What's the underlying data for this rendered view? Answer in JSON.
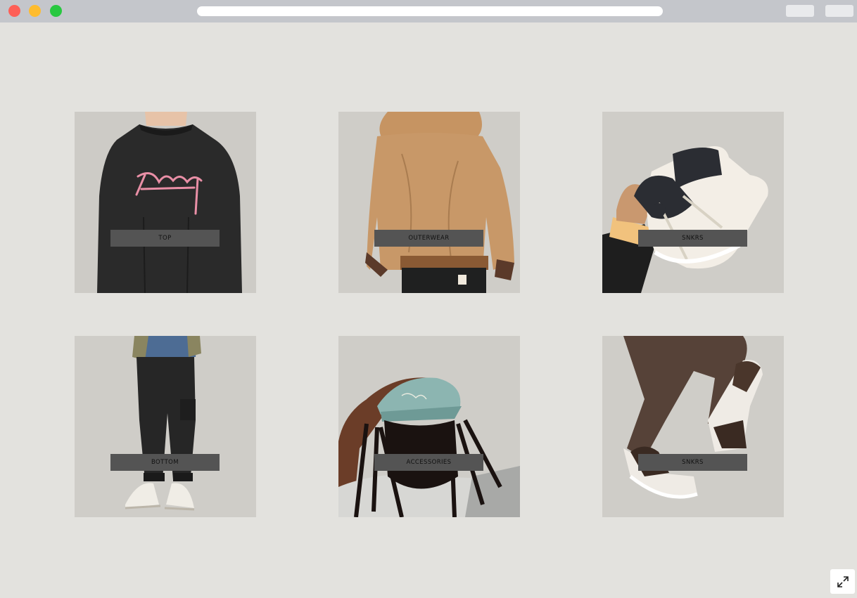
{
  "window": {
    "controls": [
      "close",
      "minimize",
      "maximize"
    ],
    "url": ""
  },
  "categories": [
    {
      "label": "TOP",
      "image": "black coach jacket with pink stussy script logo"
    },
    {
      "label": "OUTERWEAR",
      "image": "tan hooded canvas work jacket"
    },
    {
      "label": "SNKRS",
      "image": "hand holding cream and black high-top sneakers"
    },
    {
      "label": "BOTTOM",
      "image": "black cargo pants with white canvas sneakers"
    },
    {
      "label": "ACCESSORIES",
      "image": "person wearing light teal cap with embroidered logo"
    },
    {
      "label": "SNKRS",
      "image": "brown track pants with brown and white sneakers"
    }
  ],
  "colors": {
    "page_bg": "#e3e2de",
    "card_bg": "#cfcdc8",
    "label_bg": "#545454",
    "chrome": "#c4c6cb"
  },
  "fullscreen_icon": "expand-arrows-icon"
}
